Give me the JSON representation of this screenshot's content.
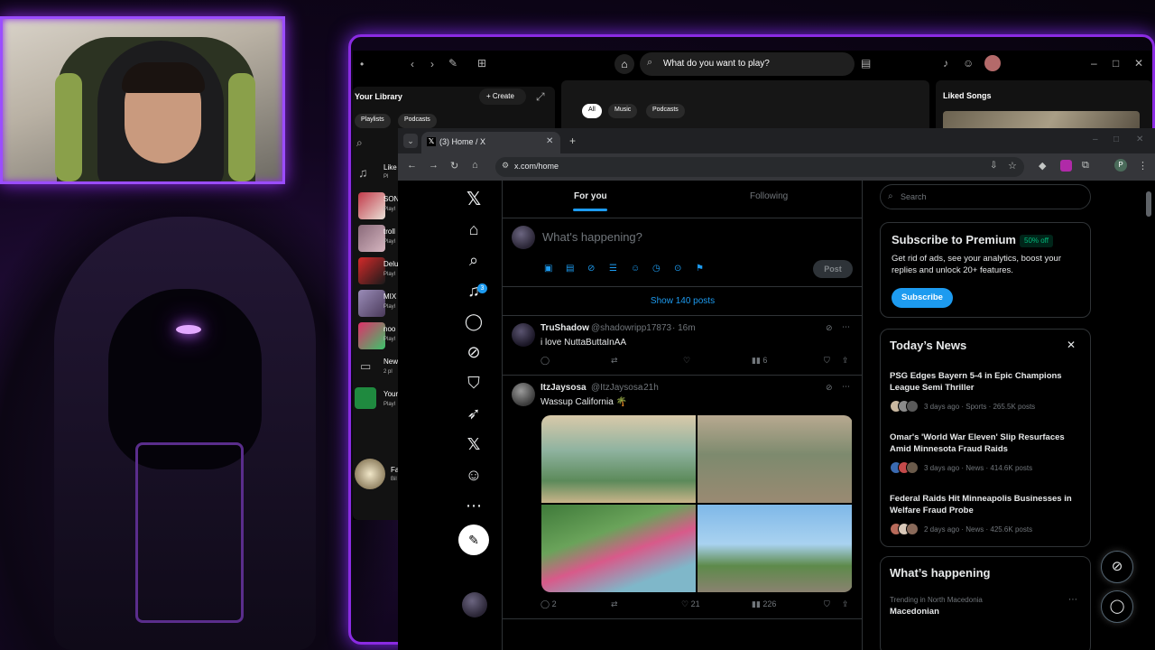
{
  "spotify": {
    "search_placeholder": "What do you want to play?",
    "library_title": "Your Library",
    "create_label": "Create",
    "lib_chips": [
      "Playlists",
      "Podcasts"
    ],
    "main_chips": [
      "All",
      "Music",
      "Podcasts"
    ],
    "liked_songs_title": "Liked Songs",
    "library_items": [
      {
        "title": "Like",
        "sub": "Pl"
      },
      {
        "title": "SON",
        "sub": "Playl"
      },
      {
        "title": "troll",
        "sub": "Playl"
      },
      {
        "title": "Delu",
        "sub": "Playl"
      },
      {
        "title": "MIX",
        "sub": "Playl"
      },
      {
        "title": "noo",
        "sub": "Playl"
      },
      {
        "title": "New",
        "sub": "2 pl"
      },
      {
        "title": "Your",
        "sub": "Playl"
      },
      {
        "title": "Fa",
        "sub": "Bil"
      }
    ]
  },
  "browser": {
    "tab_title": "(3) Home / X",
    "url": "x.com/home",
    "profile_initial": "P"
  },
  "x": {
    "nav_notif_count": "3",
    "feed_tabs": {
      "for_you": "For you",
      "following": "Following"
    },
    "composer_placeholder": "What's happening?",
    "post_button": "Post",
    "show_posts": "Show 140 posts",
    "tweets": [
      {
        "name": "TruShadow",
        "handle": "@shadowripp17873",
        "time": "· 16m",
        "text": "i love NuttaButtaInAA",
        "replies": "",
        "reposts": "",
        "likes": "",
        "views": "6"
      },
      {
        "name": "ItzJaysosa",
        "handle": "@ItzJaysosa",
        "time": "· 21h",
        "text": "Wassup California 🌴",
        "replies": "2",
        "reposts": "",
        "likes": "21",
        "views": "226"
      }
    ],
    "search_placeholder": "Search",
    "premium": {
      "title": "Subscribe to Premium",
      "badge": "50% off",
      "body": "Get rid of ads, see your analytics, boost your replies and unlock 20+ features.",
      "button": "Subscribe"
    },
    "news": {
      "title": "Today’s News",
      "items": [
        {
          "headline": "PSG Edges Bayern 5-4 in Epic Champions League Semi Thriller",
          "meta": "3 days ago · Sports · 265.5K posts"
        },
        {
          "headline": "Omar's 'World War Eleven' Slip Resurfaces Amid Minnesota Fraud Raids",
          "meta": "3 days ago · News · 414.6K posts"
        },
        {
          "headline": "Federal Raids Hit Minneapolis Businesses in Welfare Fraud Probe",
          "meta": "2 days ago · News · 425.6K posts"
        }
      ]
    },
    "happening": {
      "title": "What’s happening",
      "trend_context": "Trending in North Macedonia",
      "trend_name": "Macedonian"
    }
  },
  "colors": {
    "accent": "#1d9bf0",
    "overlay_purple": "#8a2be2",
    "spotify_green": "#1ed760"
  }
}
